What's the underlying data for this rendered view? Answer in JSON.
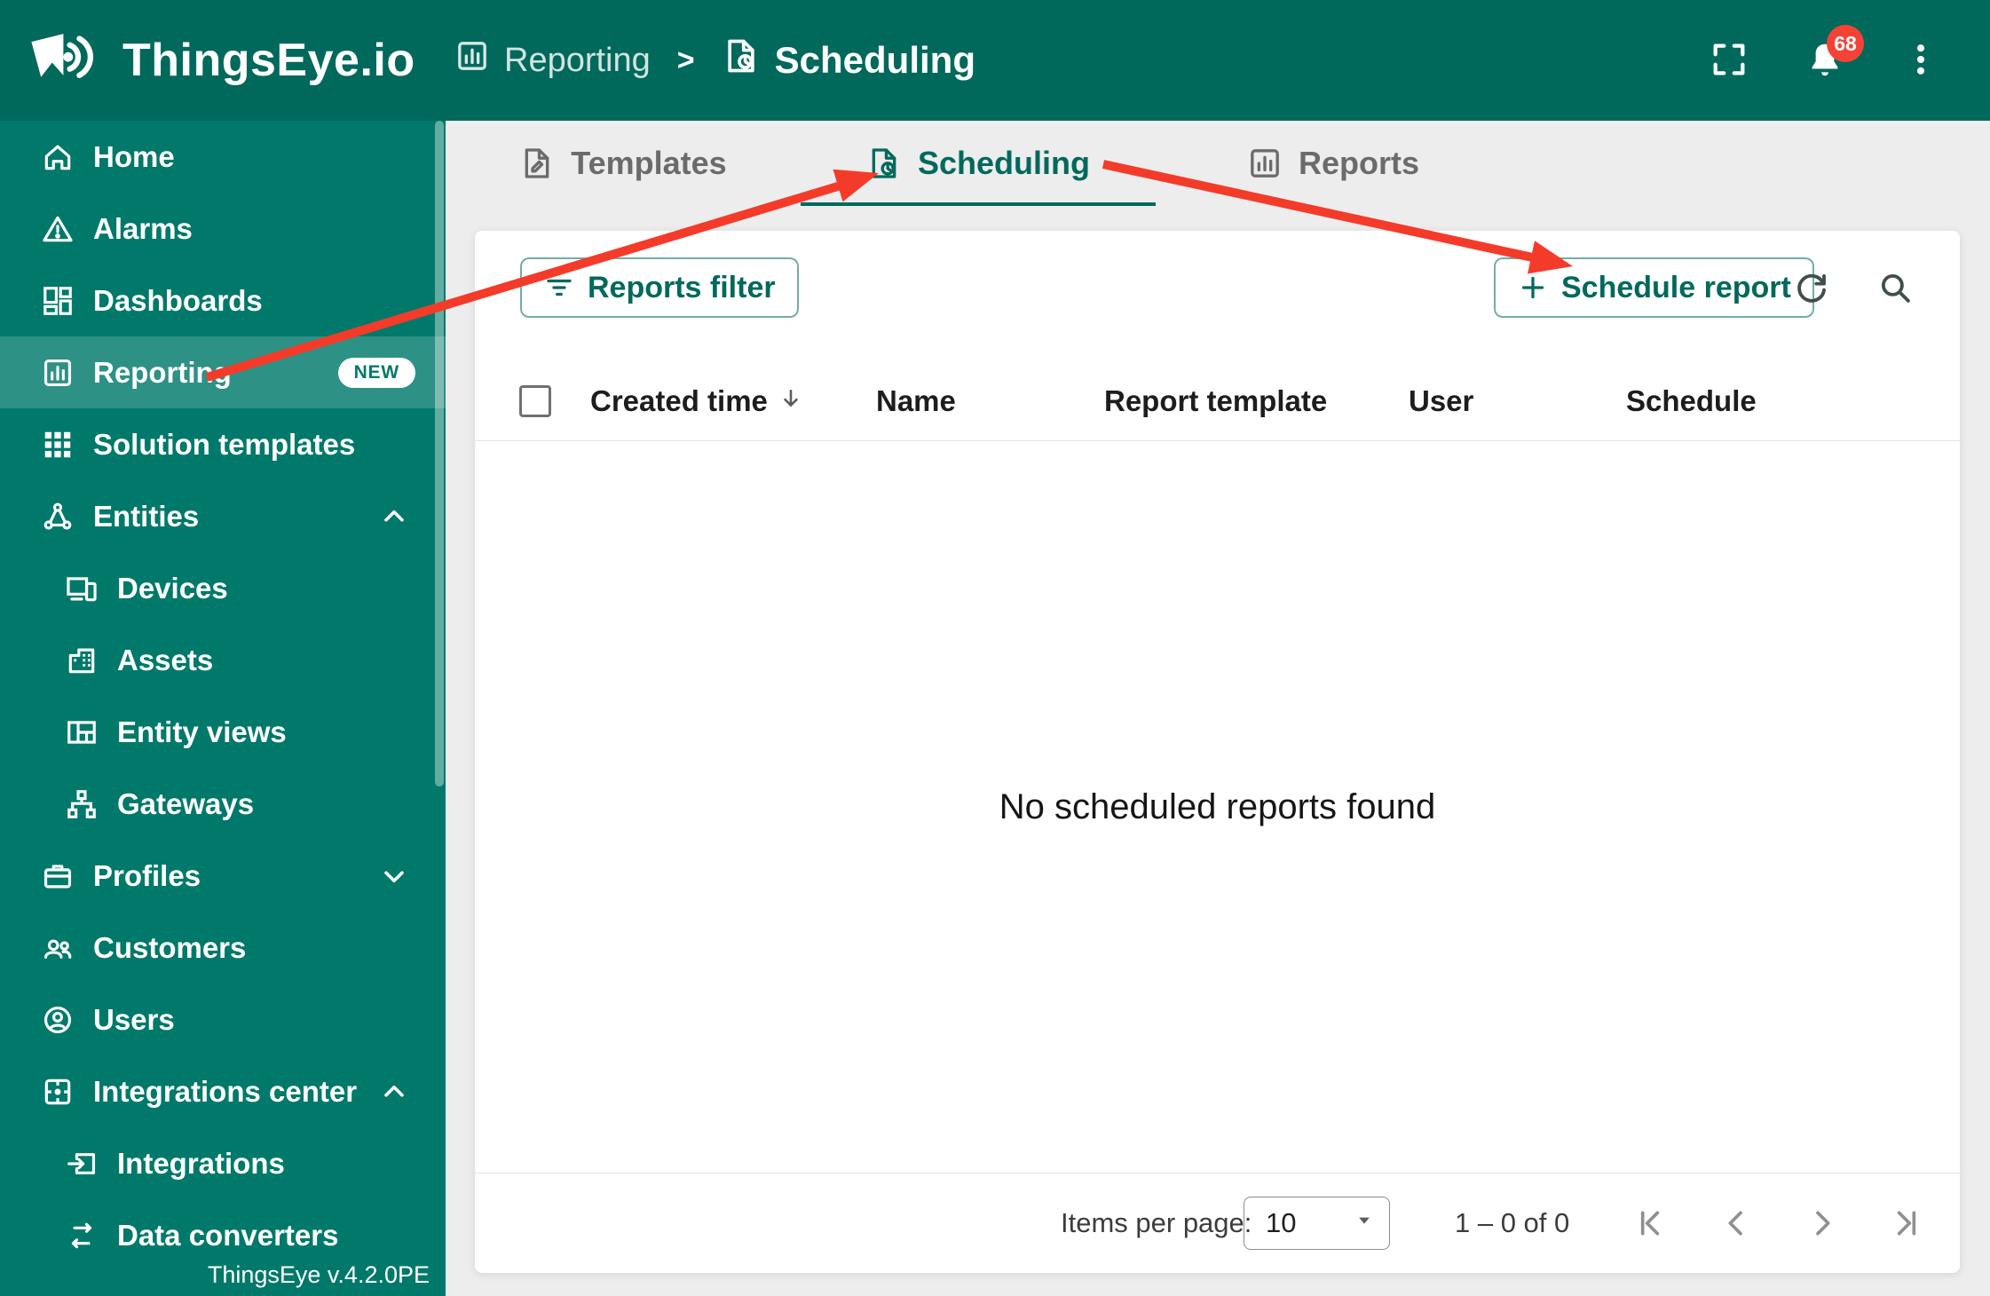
{
  "header": {
    "logo_text": "ThingsEye.io",
    "breadcrumb": {
      "separator": ">",
      "items": [
        {
          "label": "Reporting",
          "icon": "reports-icon"
        },
        {
          "label": "Scheduling",
          "icon": "scheduling-icon"
        }
      ]
    },
    "notifications_badge": "68",
    "icons": [
      "fullscreen-icon",
      "notifications-bell-icon",
      "kebab-menu-icon"
    ]
  },
  "sidebar": {
    "items": [
      {
        "label": "Home",
        "icon": "home-icon"
      },
      {
        "label": "Alarms",
        "icon": "alarms-icon"
      },
      {
        "label": "Dashboards",
        "icon": "dashboards-icon"
      },
      {
        "label": "Reporting",
        "icon": "reporting-icon",
        "badge": "NEW",
        "active": true
      },
      {
        "label": "Solution templates",
        "icon": "solution-templates-icon"
      },
      {
        "label": "Entities",
        "icon": "entities-icon",
        "expanded": true
      },
      {
        "label": "Devices",
        "icon": "devices-icon",
        "child": true
      },
      {
        "label": "Assets",
        "icon": "assets-icon",
        "child": true
      },
      {
        "label": "Entity views",
        "icon": "entity-views-icon",
        "child": true
      },
      {
        "label": "Gateways",
        "icon": "gateways-icon",
        "child": true
      },
      {
        "label": "Profiles",
        "icon": "profiles-icon",
        "expanded": false
      },
      {
        "label": "Customers",
        "icon": "customers-icon"
      },
      {
        "label": "Users",
        "icon": "users-icon"
      },
      {
        "label": "Integrations center",
        "icon": "integrations-center-icon",
        "expanded": true
      },
      {
        "label": "Integrations",
        "icon": "integrations-icon",
        "child": true
      },
      {
        "label": "Data converters",
        "icon": "data-converters-icon",
        "child": true
      }
    ],
    "version": "ThingsEye v.4.2.0PE"
  },
  "tabs": [
    {
      "label": "Templates",
      "icon": "templates-tab-icon",
      "active": false
    },
    {
      "label": "Scheduling",
      "icon": "scheduling-tab-icon",
      "active": true
    },
    {
      "label": "Reports",
      "icon": "reports-tab-icon",
      "active": false
    }
  ],
  "toolbar": {
    "filter_label": "Reports filter",
    "schedule_label": "Schedule report"
  },
  "table": {
    "columns": [
      "Created time",
      "Name",
      "Report template",
      "User",
      "Schedule"
    ],
    "sorted_column": "Created time",
    "sort_direction": "desc",
    "empty_message": "No scheduled reports found"
  },
  "pagination": {
    "items_per_page_label": "Items per page:",
    "per_page_value": "10",
    "range": "1 – 0 of 0"
  },
  "colors": {
    "header_bg": "#00695c",
    "sidebar_bg": "#00796b",
    "accent": "#00695c",
    "arrow_red": "#f43b2a",
    "badge_red": "#f44336"
  }
}
